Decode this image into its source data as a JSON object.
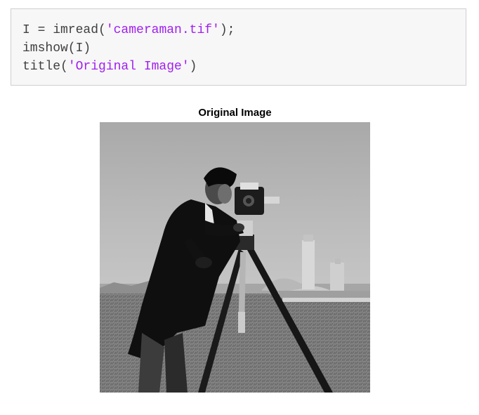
{
  "code": {
    "lines": [
      {
        "pre": "I = imread(",
        "str": "'cameraman.tif'",
        "post": ");"
      },
      {
        "pre": "imshow(I)",
        "str": "",
        "post": ""
      },
      {
        "pre": "title(",
        "str": "'Original Image'",
        "post": ")"
      }
    ]
  },
  "figure": {
    "title": "Original Image",
    "image_subject": "cameraman photograph"
  },
  "colors": {
    "string": "#a020f0",
    "code_text": "#404040",
    "code_bg": "#f7f7f7",
    "code_border": "#cfcfcf"
  }
}
